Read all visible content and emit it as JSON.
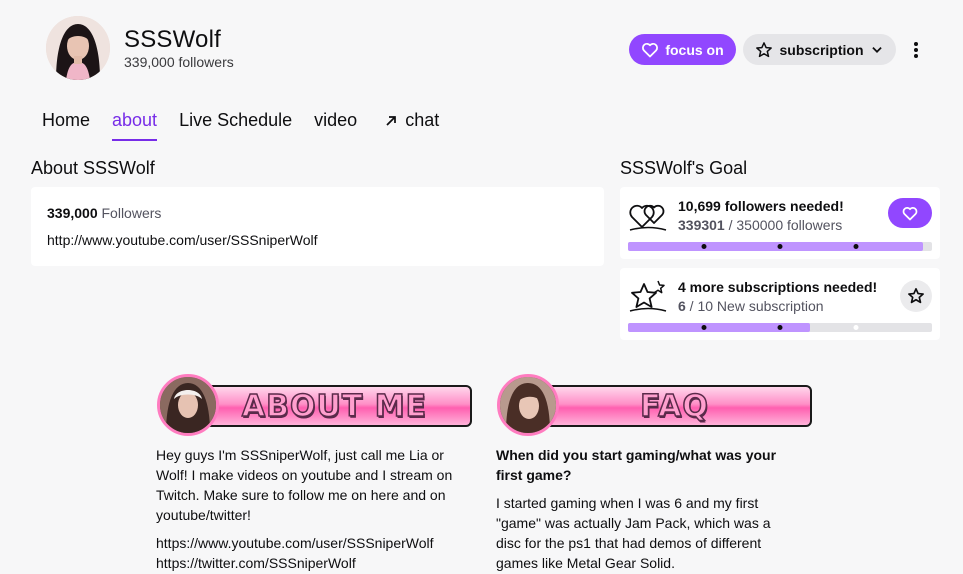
{
  "channel": {
    "name": "SSSWolf",
    "followers_text": "339,000 followers"
  },
  "actions": {
    "follow_label": "focus on",
    "subscribe_label": "subscription"
  },
  "tabs": [
    {
      "label": "Home"
    },
    {
      "label": "about"
    },
    {
      "label": "Live Schedule"
    },
    {
      "label": "video"
    },
    {
      "label": "chat"
    }
  ],
  "about": {
    "title": "About SSSWolf",
    "followers_count": "339,000",
    "followers_label": "Followers",
    "link": "http://www.youtube.com/user/SSSniperWolf"
  },
  "goals": {
    "title": "SSSWolf's Goal",
    "follower_goal": {
      "headline": "10,699 followers needed!",
      "current": "339301",
      "rest": " / 350000 followers",
      "progress": 0.969
    },
    "sub_goal": {
      "headline": "4 more subscriptions needed!",
      "current": "6",
      "rest": " / 10 New subscription",
      "progress": 0.6
    }
  },
  "panels": {
    "about_me": {
      "banner": "ABOUT ME",
      "text": "Hey guys I'm SSSniperWolf, just call me Lia or Wolf! I make videos on youtube and I stream on Twitch. Make sure to follow me on here and on youtube/twitter!",
      "link1": "https://www.youtube.com/user/SSSniperWolf",
      "link2": "https://twitter.com/SSSniperWolf"
    },
    "faq": {
      "banner": "FAQ",
      "question": "When did you start gaming/what was your first game?",
      "answer": "I started gaming when I was 6 and my first \"game\" was actually Jam Pack, which was a disc for the ps1 that had demos of different games like Metal Gear Solid."
    }
  },
  "colors": {
    "accent": "#9147ff",
    "active_tab": "#772ce8",
    "progress_fill": "#bf94ff",
    "banner_pink": "#ff7cc0"
  }
}
